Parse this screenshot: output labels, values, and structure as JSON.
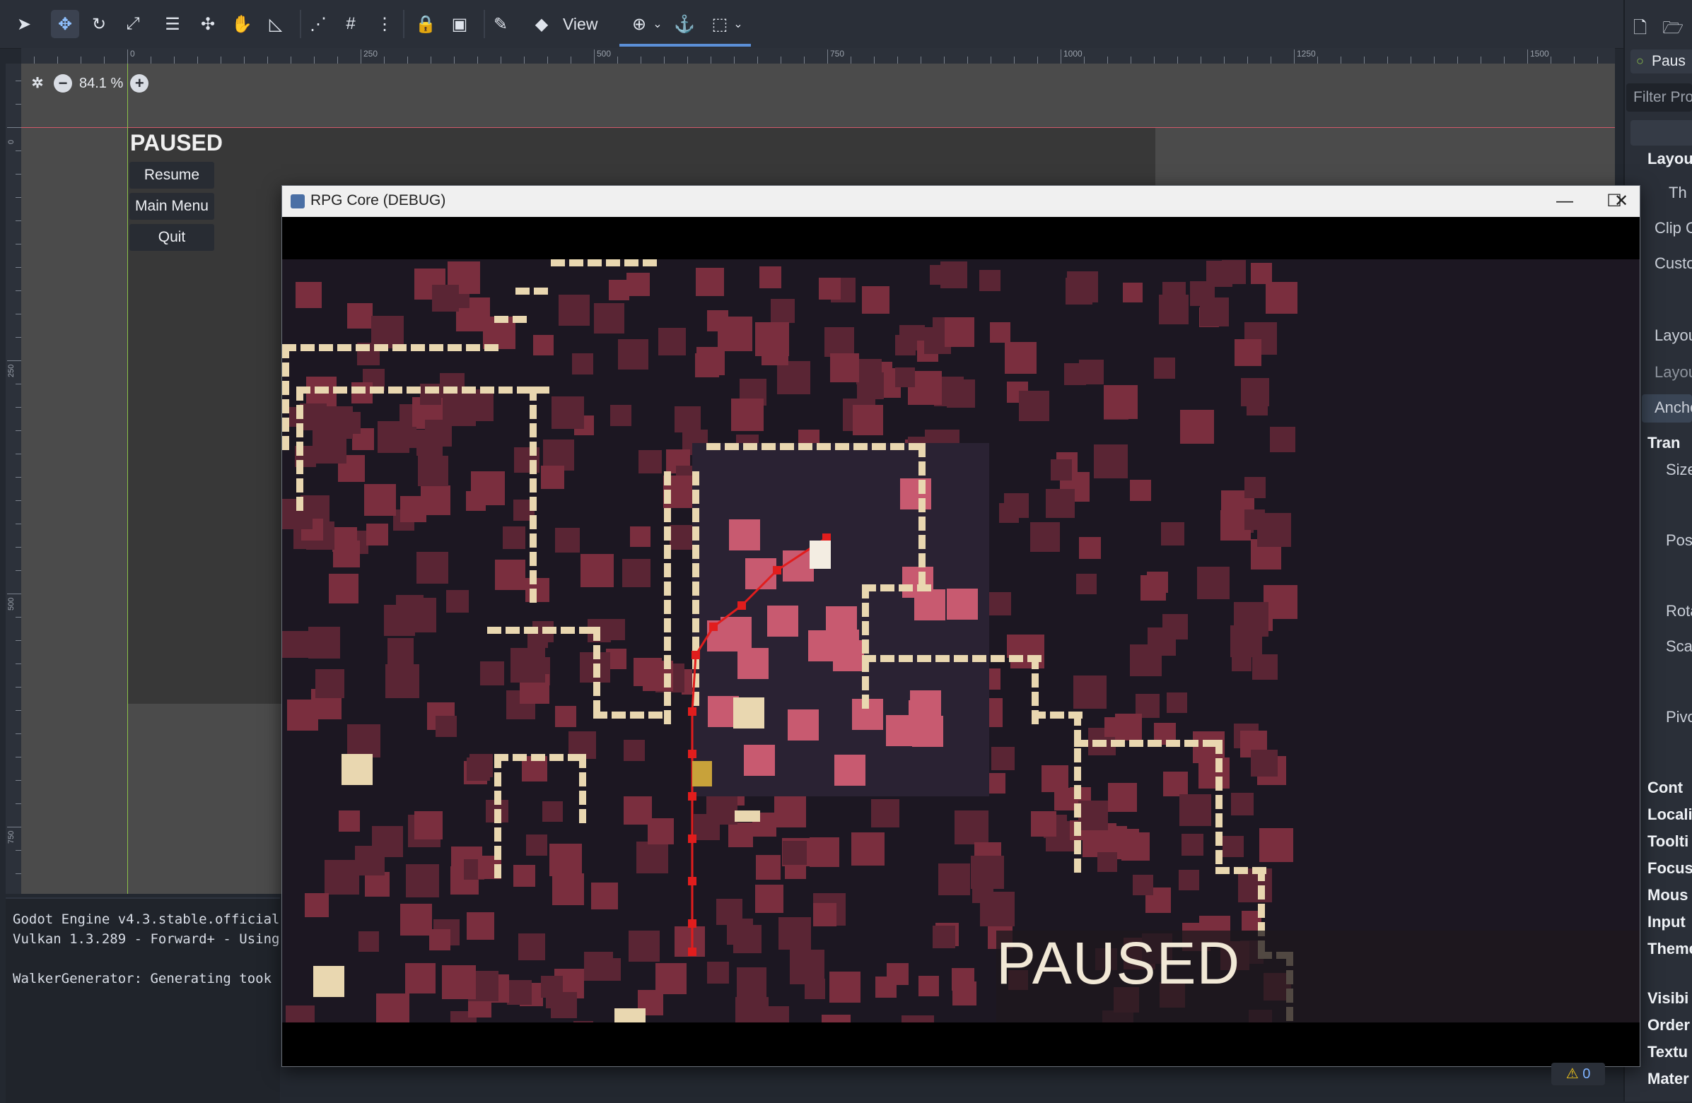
{
  "toolbar": {
    "view_label": "View"
  },
  "ruler": {
    "top_labels": [
      "0",
      "250",
      "500",
      "750",
      "1000",
      "1250",
      "1500"
    ],
    "left_labels": [
      "0",
      "250",
      "500",
      "750"
    ]
  },
  "viewport": {
    "zoom": "84.1 %",
    "scene_title": "PAUSED",
    "buttons": [
      "Resume",
      "Main Menu",
      "Quit"
    ]
  },
  "output": {
    "lines": [
      "Godot Engine v4.3.stable.official",
      "Vulkan 1.3.289 - Forward+ - Using",
      "",
      "WalkerGenerator: Generating took"
    ]
  },
  "inspector": {
    "node_name": "Paus",
    "filter_placeholder": "Filter Pro",
    "rows": [
      {
        "text": "Layou",
        "style": "bold"
      },
      {
        "text": "Th",
        "style": "normal"
      },
      {
        "text": "Clip C",
        "style": "normal"
      },
      {
        "text": "Custo",
        "style": "normal"
      },
      {
        "text": "Layou",
        "style": "normal"
      },
      {
        "text": "Layou",
        "style": "dim"
      },
      {
        "text": "Ancho",
        "style": "normal"
      },
      {
        "text": "Tran",
        "style": "bold"
      },
      {
        "text": "Size",
        "style": "normal"
      },
      {
        "text": "Posi",
        "style": "normal"
      },
      {
        "text": "Rota",
        "style": "normal"
      },
      {
        "text": "Scal",
        "style": "normal"
      },
      {
        "text": "Pivo",
        "style": "normal"
      },
      {
        "text": "Cont",
        "style": "bold"
      },
      {
        "text": "Locali",
        "style": "bold"
      },
      {
        "text": "Toolti",
        "style": "bold"
      },
      {
        "text": "Focus",
        "style": "bold"
      },
      {
        "text": "Mous",
        "style": "bold"
      },
      {
        "text": "Input",
        "style": "bold"
      },
      {
        "text": "Theme",
        "style": "bold"
      },
      {
        "text": "Visibi",
        "style": "bold"
      },
      {
        "text": "Order",
        "style": "bold"
      },
      {
        "text": "Textu",
        "style": "bold"
      },
      {
        "text": "Mater",
        "style": "bold"
      }
    ]
  },
  "game_window": {
    "title": "RPG Core (DEBUG)",
    "paused_text": "PAUSED"
  },
  "status": {
    "warnings": "0"
  },
  "colors": {
    "accent": "#5b8fd7",
    "guide_horizontal": "#d05a6a",
    "guide_vertical": "#8cc24a",
    "wall": "#e9d7b0",
    "floor_pattern": "#7a2e3e",
    "path": "#e11d1d"
  }
}
